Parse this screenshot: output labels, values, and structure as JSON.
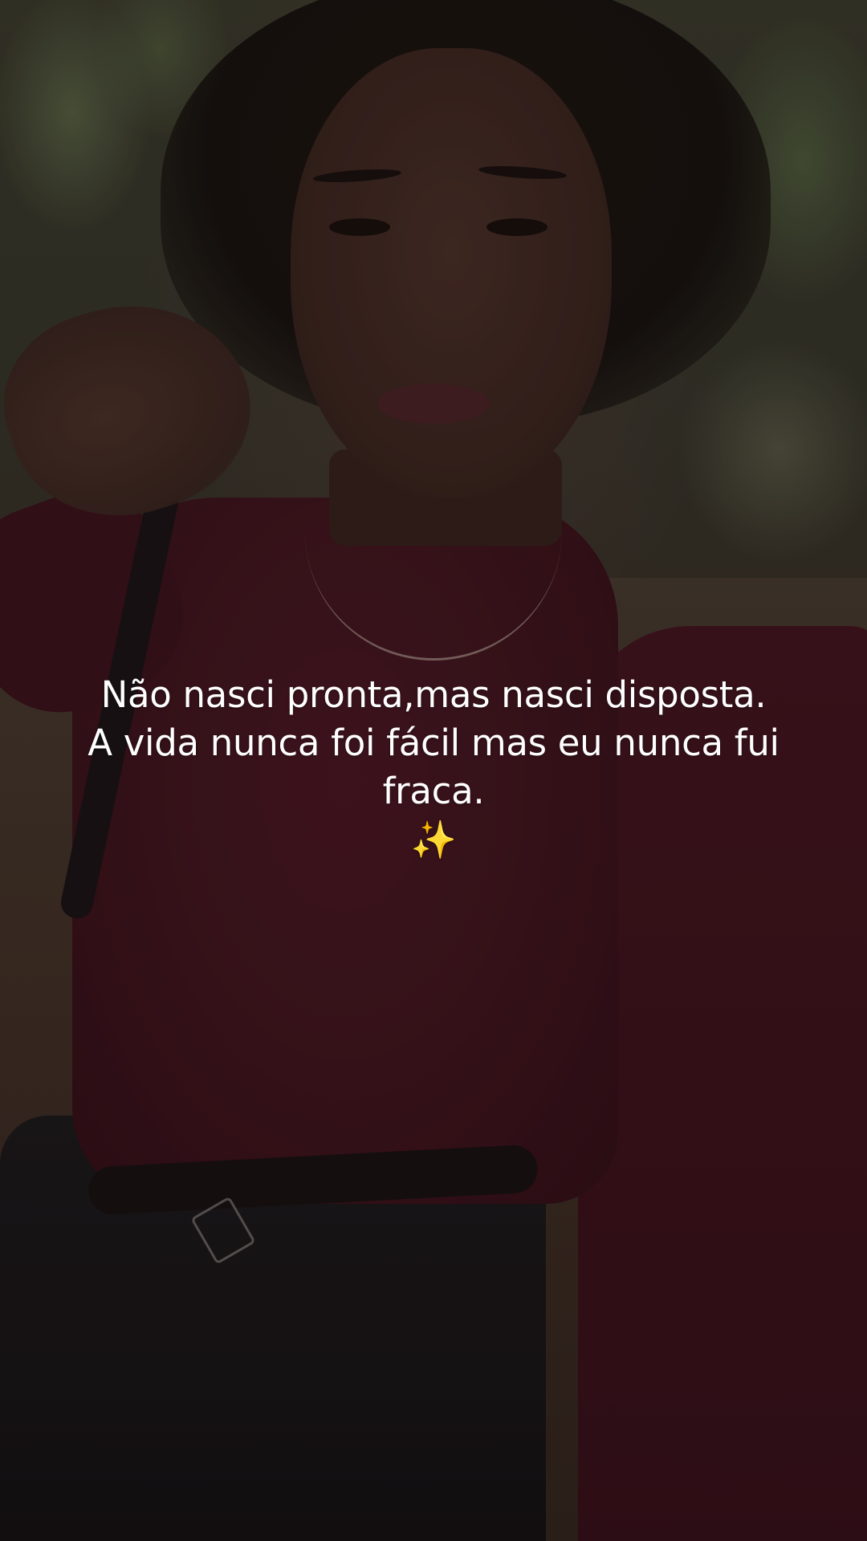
{
  "caption": {
    "line1": "Não nasci pronta,mas nasci disposta.",
    "line2": "A vida nunca foi fácil mas eu nunca fui",
    "line3": "fraca.",
    "emoji": "✨"
  },
  "colors": {
    "text": "#ffffff",
    "top": "#3e141d"
  }
}
